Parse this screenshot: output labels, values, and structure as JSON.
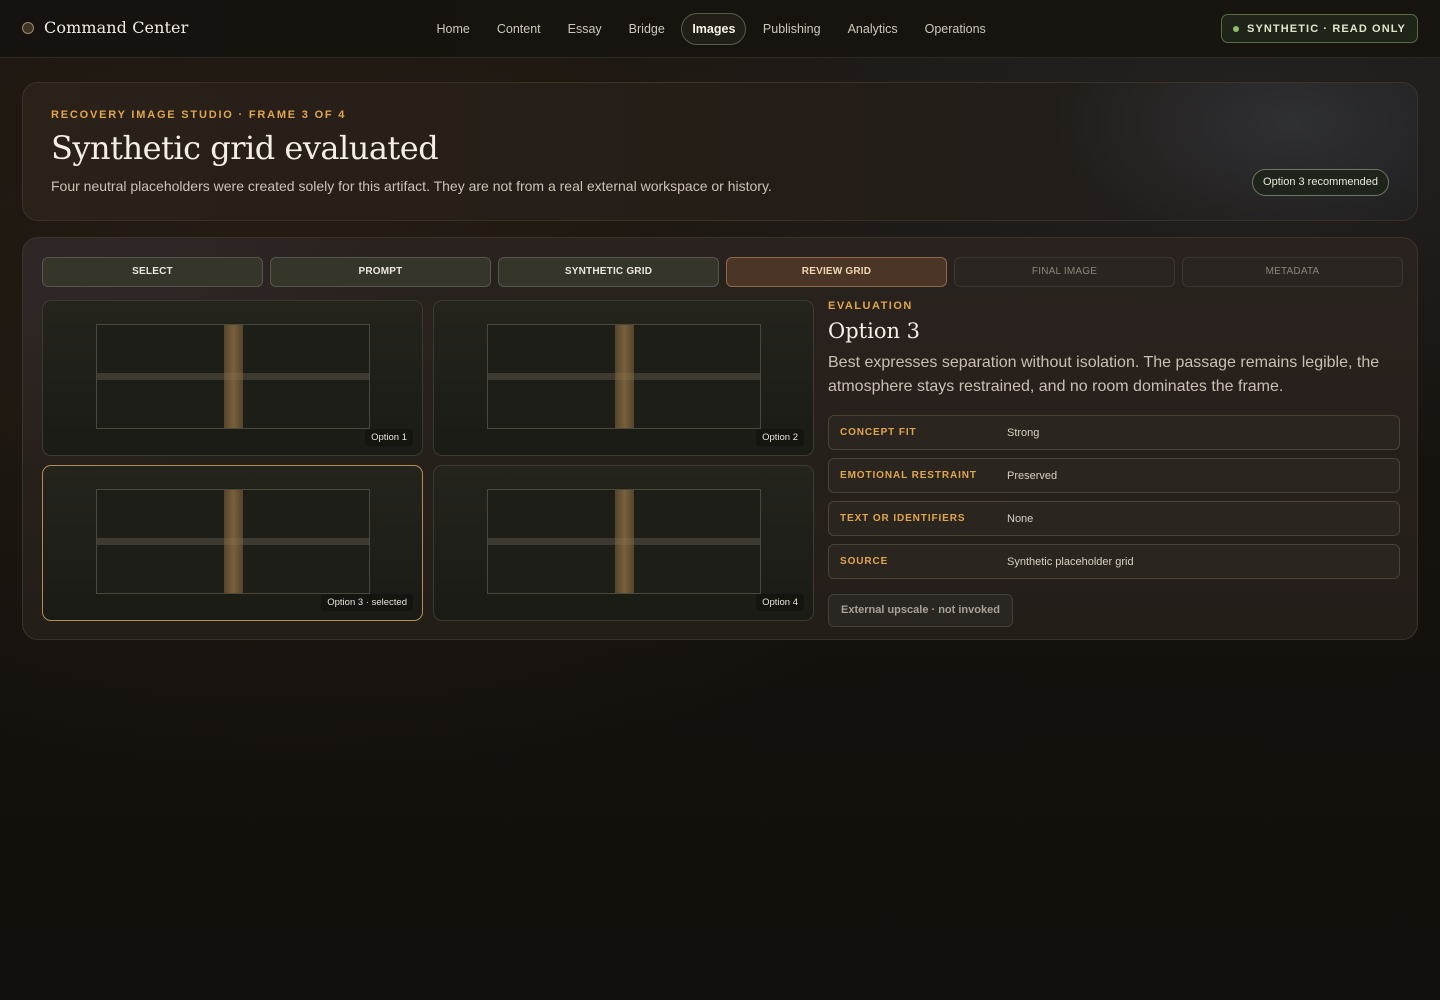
{
  "app": {
    "title": "Command Center"
  },
  "nav": {
    "items": [
      "Home",
      "Content",
      "Essay",
      "Bridge",
      "Images",
      "Publishing",
      "Analytics",
      "Operations"
    ],
    "active": "Images"
  },
  "badge": {
    "readonly": "SYNTHETIC · READ ONLY",
    "dot_color": "#8fbf6a"
  },
  "hero": {
    "eyebrow": "RECOVERY IMAGE STUDIO · FRAME 3 OF 4",
    "title": "Synthetic grid evaluated",
    "subtitle": "Four neutral placeholders were created solely for this artifact. They are not from a real external workspace or history.",
    "recommendation": "Option 3 recommended"
  },
  "steps": [
    {
      "label": "SELECT",
      "state": "done"
    },
    {
      "label": "PROMPT",
      "state": "done"
    },
    {
      "label": "SYNTHETIC GRID",
      "state": "done"
    },
    {
      "label": "REVIEW GRID",
      "state": "current"
    },
    {
      "label": "FINAL IMAGE",
      "state": "pending"
    },
    {
      "label": "METADATA",
      "state": "pending"
    }
  ],
  "grid": {
    "options": [
      {
        "label": "Option 1",
        "selected": false
      },
      {
        "label": "Option 2",
        "selected": false
      },
      {
        "label": "Option 3 · selected",
        "selected": true
      },
      {
        "label": "Option 4",
        "selected": false
      }
    ]
  },
  "evaluation": {
    "eyebrow": "EVALUATION",
    "title": "Option 3",
    "description": "Best expresses separation without isolation. The passage remains legible, the atmosphere stays restrained, and no room dominates the frame.",
    "rows": [
      {
        "key": "CONCEPT FIT",
        "value": "Strong"
      },
      {
        "key": "EMOTIONAL RESTRAINT",
        "value": "Preserved"
      },
      {
        "key": "TEXT OR IDENTIFIERS",
        "value": "None"
      },
      {
        "key": "SOURCE",
        "value": "Synthetic placeholder grid"
      }
    ],
    "upscale_button": "External upscale · not invoked"
  },
  "colors": {
    "accent": "#e0a64f",
    "selected_border": "#b58e55",
    "current_step_bg": "#4a3526"
  }
}
